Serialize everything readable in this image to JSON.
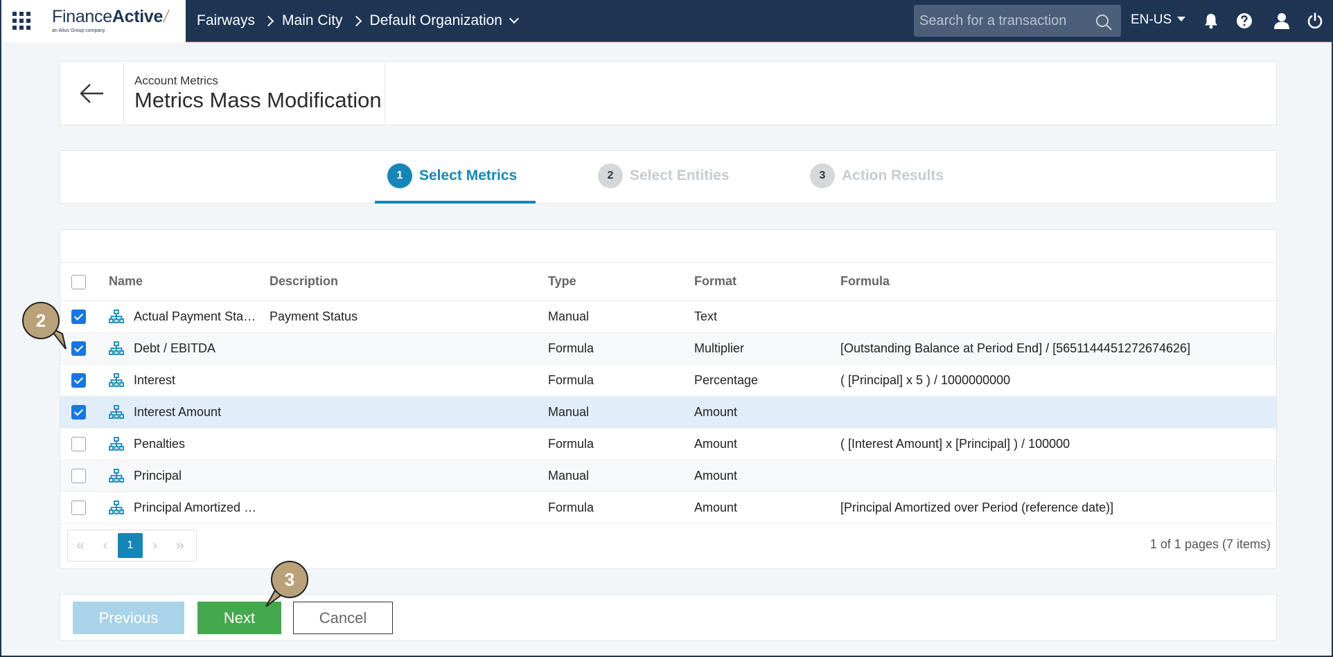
{
  "topbar": {
    "logo_main": "Finance",
    "logo_bold": "Active",
    "logo_sub": "an Altus Group company",
    "breadcrumb": [
      "Fairways",
      "Main City",
      "Default Organization"
    ],
    "search_placeholder": "Search for a transaction",
    "language": "EN-US"
  },
  "header": {
    "subtitle": "Account Metrics",
    "title": "Metrics Mass Modification"
  },
  "steps": [
    {
      "num": "1",
      "label": "Select Metrics",
      "state": "active"
    },
    {
      "num": "2",
      "label": "Select Entities",
      "state": "inactive"
    },
    {
      "num": "3",
      "label": "Action Results",
      "state": "inactive"
    }
  ],
  "table": {
    "columns": [
      "Name",
      "Description",
      "Type",
      "Format",
      "Formula"
    ],
    "rows": [
      {
        "checked": true,
        "name": "Actual Payment Sta…",
        "description": "Payment Status",
        "type": "Manual",
        "format": "Text",
        "formula": ""
      },
      {
        "checked": true,
        "name": "Debt / EBITDA",
        "description": "",
        "type": "Formula",
        "format": "Multiplier",
        "formula": "[Outstanding Balance at Period End] / [5651144451272674626]"
      },
      {
        "checked": true,
        "name": "Interest",
        "description": "",
        "type": "Formula",
        "format": "Percentage",
        "formula": "( [Principal] x 5 ) / 1000000000"
      },
      {
        "checked": true,
        "name": "Interest Amount",
        "description": "",
        "type": "Manual",
        "format": "Amount",
        "formula": ""
      },
      {
        "checked": false,
        "name": "Penalties",
        "description": "",
        "type": "Formula",
        "format": "Amount",
        "formula": "( [Interest Amount] x [Principal] ) / 100000"
      },
      {
        "checked": false,
        "name": "Principal",
        "description": "",
        "type": "Manual",
        "format": "Amount",
        "formula": ""
      },
      {
        "checked": false,
        "name": "Principal Amortized …",
        "description": "",
        "type": "Formula",
        "format": "Amount",
        "formula": "[Principal Amortized over Period (reference date)]"
      }
    ]
  },
  "pager": {
    "current_page": "1",
    "info": "1 of 1 pages (7 items)"
  },
  "actions": {
    "previous": "Previous",
    "next": "Next",
    "cancel": "Cancel"
  },
  "callouts": [
    "2",
    "3"
  ],
  "colors": {
    "topbar": "#1e3554",
    "accent": "#1586b5",
    "next_button": "#44a84c",
    "callout": "#b9a27a"
  }
}
